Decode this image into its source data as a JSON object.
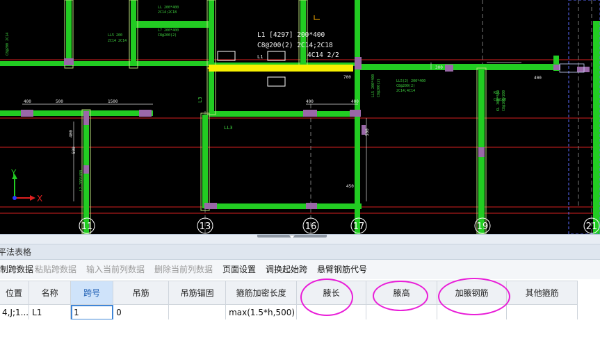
{
  "drawing": {
    "beam_label_lines": [
      "L1 [4297] 200*400",
      "C8@200(2) 2C14;2C18",
      "4C14 2/2"
    ],
    "beam_tag": "L1",
    "grid_axes": [
      "11",
      "13",
      "16",
      "17",
      "19",
      "21"
    ],
    "axis_y": "Y",
    "axis_x": "X",
    "annotations": {
      "left_small": "LL 200*400",
      "beam_ll3": "LL3",
      "beam_l3": "L3",
      "dim_400": "400",
      "dim_500": "500",
      "dim_1500": "1500",
      "dim_700": "700",
      "dim_300": "300",
      "dim_450": "450"
    },
    "colors": {
      "beam": "#22cc22",
      "selected": "#f7f000",
      "grid_line": "#d61f1f",
      "column": "#9a68a8"
    }
  },
  "panel": {
    "title": "平法表格"
  },
  "toolbar": {
    "items": [
      {
        "label": "复制跨数据",
        "disabled": false
      },
      {
        "label": "粘贴跨数据",
        "disabled": true
      },
      {
        "label": "输入当前列数据",
        "disabled": true
      },
      {
        "label": "删除当前列数据",
        "disabled": true
      },
      {
        "label": "页面设置",
        "disabled": false
      },
      {
        "label": "调换起始跨",
        "disabled": false
      },
      {
        "label": "悬臂钢筋代号",
        "disabled": false
      }
    ]
  },
  "table": {
    "headers": [
      "位置",
      "名称",
      "跨号",
      "吊筋",
      "吊筋锚固",
      "箍筋加密长度",
      "腋长",
      "腋高",
      "加腋钢筋",
      "其他箍筋"
    ],
    "row": [
      "4,J;1...",
      "L1",
      "1",
      "0",
      "",
      "max(1.5*h,500)",
      "",
      "",
      "",
      ""
    ]
  },
  "highlighted_columns": [
    "腋长",
    "腋高",
    "加腋钢筋"
  ]
}
